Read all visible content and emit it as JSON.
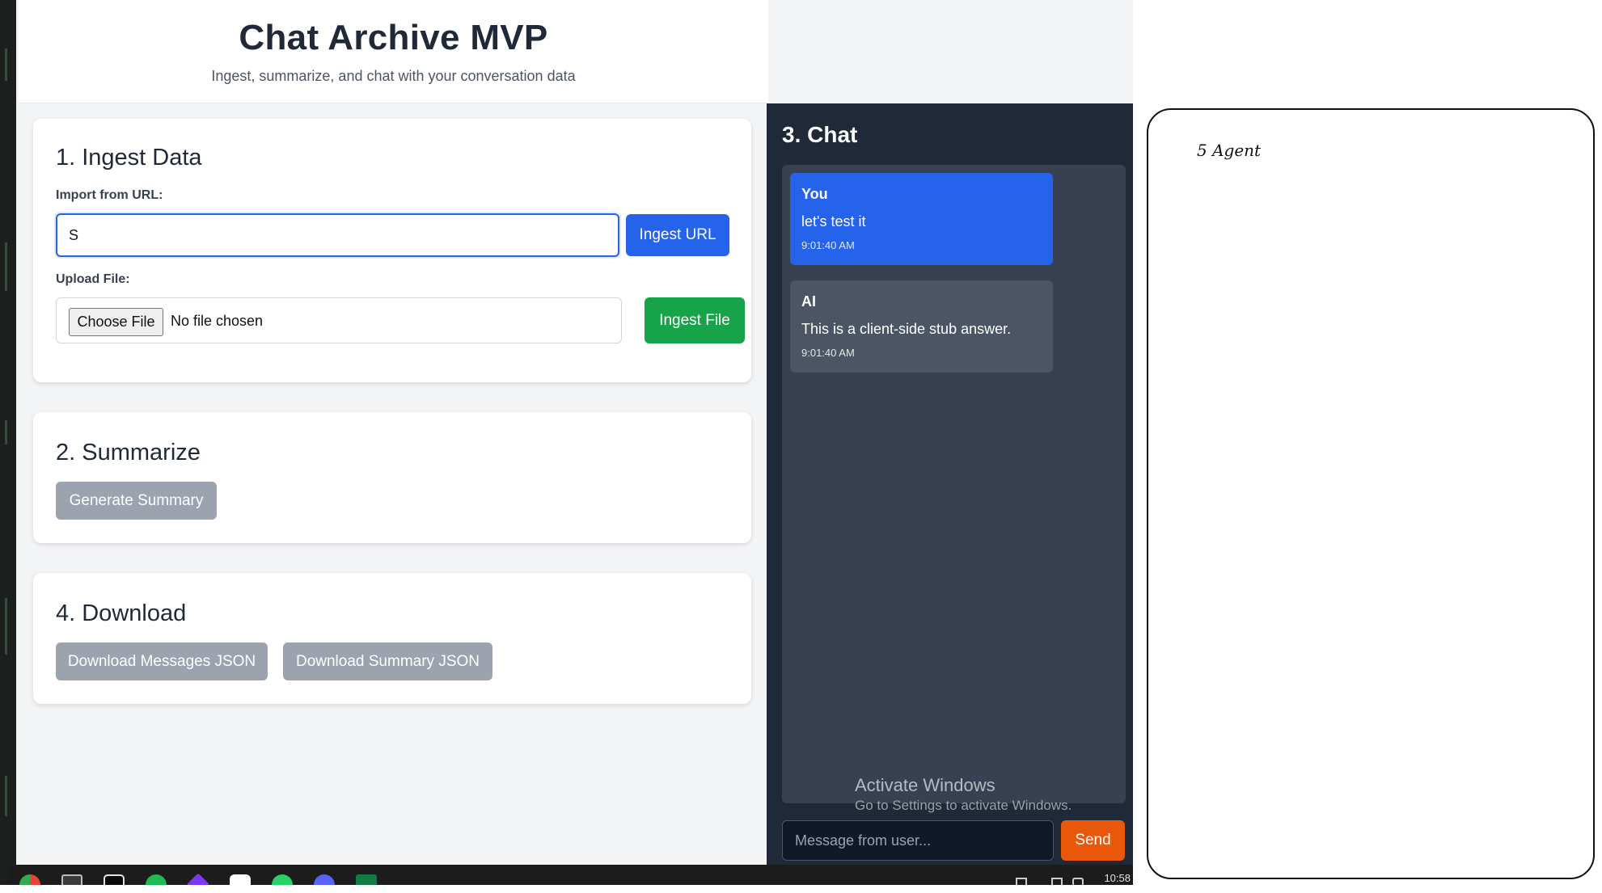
{
  "app": {
    "title": "Chat Archive MVP",
    "subtitle": "Ingest, summarize, and chat with your conversation data"
  },
  "ingest": {
    "heading": "1. Ingest Data",
    "url_label": "Import from URL:",
    "url_value": "S",
    "ingest_url_button": "Ingest URL",
    "file_label": "Upload File:",
    "choose_file_button": "Choose File",
    "file_status": "No file chosen",
    "ingest_file_button": "Ingest File"
  },
  "summarize": {
    "heading": "2. Summarize",
    "generate_button": "Generate Summary"
  },
  "download": {
    "heading": "4. Download",
    "messages_button": "Download Messages JSON",
    "summary_button": "Download Summary JSON"
  },
  "chat": {
    "heading": "3. Chat",
    "messages": [
      {
        "sender": "You",
        "text": "let's test it",
        "time": "9:01:40 AM"
      },
      {
        "sender": "AI",
        "text": "This is a client-side stub answer.",
        "time": "9:01:40 AM"
      }
    ],
    "input_placeholder": "Message from user...",
    "send_button": "Send"
  },
  "windows_overlay": {
    "title": "Activate Windows",
    "subtitle": "Go to Settings to activate Windows."
  },
  "taskbar": {
    "clock": "10:58",
    "icons": [
      "chrome-icon",
      "terminal-icon",
      "app-icon",
      "spotify-icon",
      "obsidian-icon",
      "chatgpt-icon",
      "whatsapp-icon",
      "discord-icon",
      "excel-icon"
    ]
  },
  "side_card": {
    "label": "5 Agent"
  },
  "colors": {
    "primary": "#2563eb",
    "success": "#16a34a",
    "disabled": "#9ca3af",
    "send": "#ea580c",
    "chat_bg": "#1f2937"
  }
}
